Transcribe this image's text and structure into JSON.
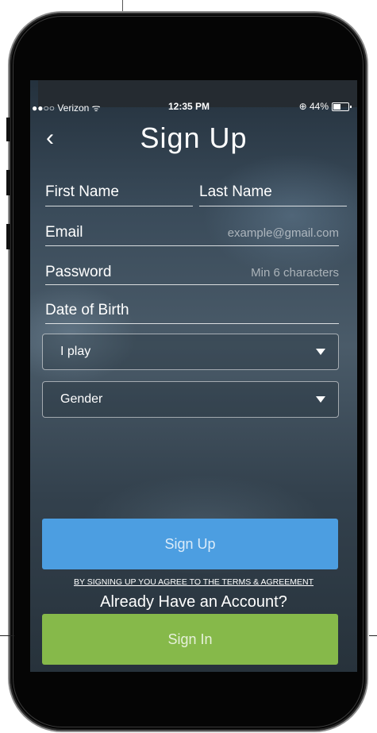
{
  "status_bar": {
    "carrier": "●●○○ Verizon ᯤ",
    "time": "12:35 PM",
    "battery": "⊕ 44%"
  },
  "header": {
    "title": "Sign Up"
  },
  "form": {
    "first_name_label": "First Name",
    "last_name_label": "Last Name",
    "email_label": "Email",
    "email_placeholder": "example@gmail.com",
    "password_label": "Password",
    "password_placeholder": "Min 6 characters",
    "dob_label": "Date of Birth",
    "play_select": "I play",
    "gender_select": "Gender"
  },
  "actions": {
    "signup_label": "Sign Up",
    "terms_text": "BY SIGNING UP YOU AGREE TO THE TERMS & AGREEMENT",
    "already_text": "Already Have an Account?",
    "signin_label": "Sign In"
  },
  "colors": {
    "signup_button": "#4c9ee1",
    "signin_button": "#86b94a"
  }
}
